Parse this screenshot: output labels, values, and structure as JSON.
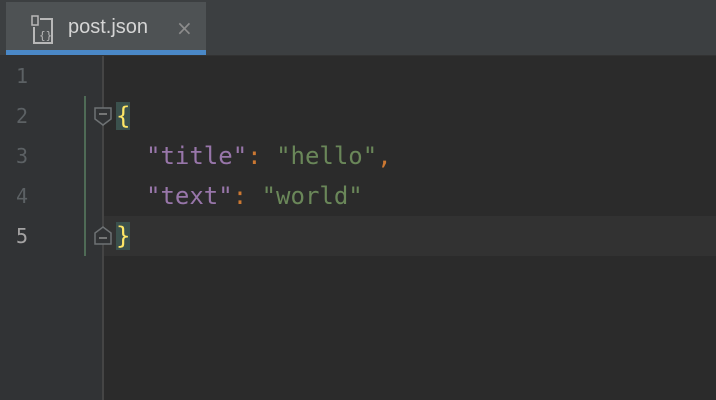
{
  "tab": {
    "label": "post.json",
    "close_glyph": "×",
    "icon": "json-file-icon"
  },
  "editor": {
    "line_numbers": [
      "1",
      "2",
      "3",
      "4",
      "5"
    ],
    "current_line": 5,
    "code": {
      "open_brace": "{",
      "title_key": "\"title\"",
      "title_colon": ": ",
      "title_value": "\"hello\"",
      "title_comma": ",",
      "text_key": "\"text\"",
      "text_colon": ": ",
      "text_value": "\"world\"",
      "close_brace": "}"
    }
  },
  "colors": {
    "background": "#2b2b2b",
    "gutter": "#313335",
    "tab_accent": "#4a88c7",
    "key": "#9876aa",
    "string": "#6a8759",
    "punctuation": "#cc7832",
    "brace": "#ffe766"
  }
}
